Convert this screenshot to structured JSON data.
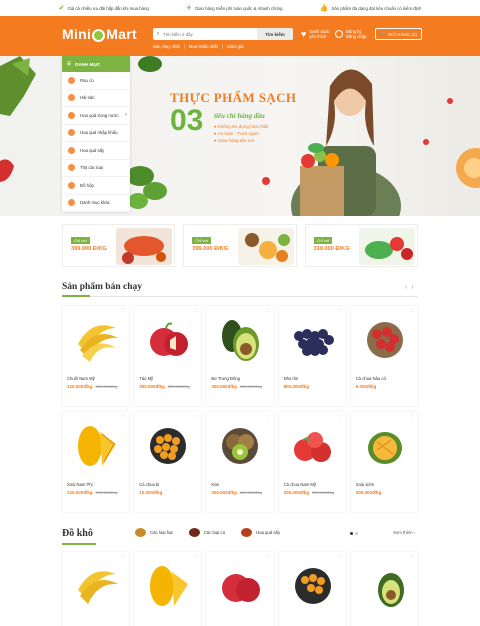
{
  "topbar": {
    "items": [
      {
        "icon": "check-icon",
        "text": "Giá cả nhiều ưu đãi hấp dẫn khi mua hàng"
      },
      {
        "icon": "plane-icon",
        "text": "Giao hàng miễn phí toàn quốc & nhanh chóng"
      },
      {
        "icon": "thumbs-up-icon",
        "text": "Sản phẩm đa dạng đạt tiêu chuẩn có kiểm định"
      }
    ]
  },
  "header": {
    "logo_left": "Mini",
    "logo_right": "Mart",
    "search_placeholder": "Tìm kiếm ở đây",
    "search_button": "Tìm kiếm",
    "quick_links": [
      "Bán chạy nhất",
      "|",
      "Mua nhiều nhất",
      "|",
      "Giảm giá"
    ],
    "wishlist_line1": "Danh sách",
    "wishlist_line2": "yêu thích",
    "account_line1": "Đăng ký",
    "account_line2": "Đăng nhập",
    "cart_label": "GIỎ HÀNG (0)"
  },
  "categories": {
    "heading": "DANH MỤC",
    "items": [
      "Rau củ",
      "Hải sản",
      "Hoa quả trong nước",
      "Hoa quả nhập khẩu",
      "Hoa quả sấy",
      "Thịt các loại",
      "Đồ hộp",
      "Danh mục khác"
    ]
  },
  "hero": {
    "title": "THỰC PHẨM SẠCH",
    "number": "03",
    "subtitle": "tiêu chí hàng đầu",
    "bullets": [
      "Không sử dụng hóa chất",
      "An toàn - Tươi ngon",
      "Giao hàng tận nơi"
    ]
  },
  "promos": [
    {
      "tag": "Chỉ với",
      "price": "399.000 Đ/KG"
    },
    {
      "tag": "Chỉ với",
      "price": "399.000 Đ/KG"
    },
    {
      "tag": "Chỉ với",
      "price": "310.000 Đ/KG"
    }
  ],
  "best_sellers": {
    "title": "Sản phẩm bán chạy",
    "products": [
      {
        "name": "Chuối Nam Mỹ",
        "price": "120.000đ/kg",
        "old": "150.000đ/kg"
      },
      {
        "name": "Táo Mỹ",
        "price": "300.000đ/kg",
        "old": "320.000đ/kg"
      },
      {
        "name": "Bơ Trung Đông",
        "price": "300.000đ/kg",
        "old": "350.000đ/kg"
      },
      {
        "name": "Nho tím",
        "price": "800.000đ/kg",
        "old": ""
      },
      {
        "name": "Cà chua Nâu cờ",
        "price": "5.000đ/kg",
        "old": ""
      },
      {
        "name": "Xoài Nam Phi",
        "price": "120.000đ/kg",
        "old": "150.000đ/kg"
      },
      {
        "name": "Cà chua bi",
        "price": "10.000đ/kg",
        "old": ""
      },
      {
        "name": "Kiwi",
        "price": "300.000đ/kg",
        "old": "350.000đ/kg"
      },
      {
        "name": "Cà chua Nam Mỹ",
        "price": "200.000đ/kg",
        "old": "300.000đ/kg"
      },
      {
        "name": "Xoài xiêm",
        "price": "300.000đ/kg",
        "old": ""
      }
    ]
  },
  "dry_food": {
    "title": "Đồ khô",
    "tabs": [
      "Các loại hạt",
      "Các loại củ",
      "Hoa quả sấy"
    ],
    "more": "Xem thêm ›"
  },
  "colors": {
    "brand_orange": "#f47b20",
    "brand_green": "#7cb342"
  }
}
